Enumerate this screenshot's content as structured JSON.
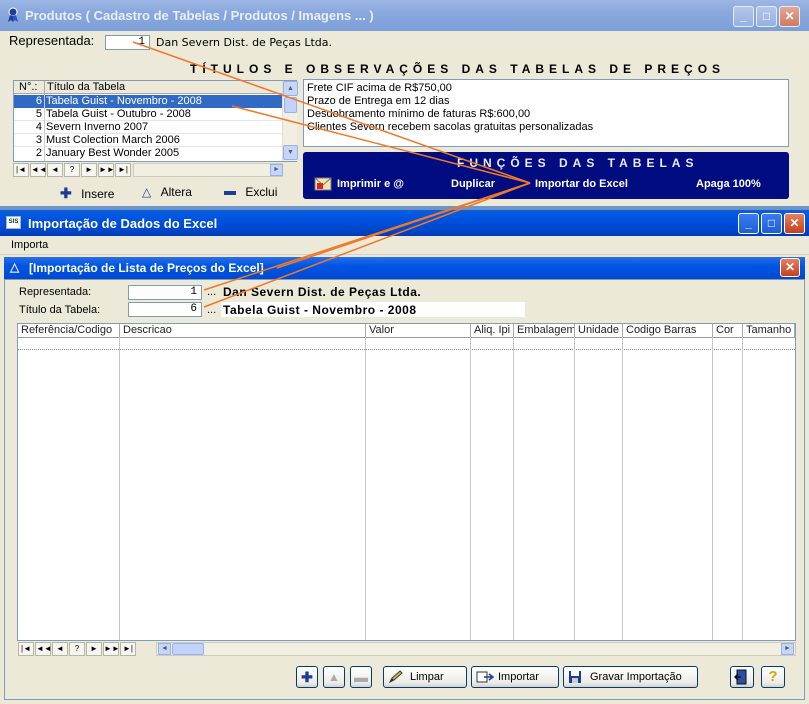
{
  "window1": {
    "title": "Produtos ( Cadastro de Tabelas / Produtos / Imagens ... )",
    "representada_label": "Representada:",
    "representada_value": "1",
    "representada_name": "Dan Severn Dist. de Peças Ltda.",
    "section_title": "TÍTULOS E OBSERVAÇÕES DAS TABELAS DE PREÇOS",
    "list_headers": {
      "num": "N°.:",
      "title": "Título da Tabela"
    },
    "list_items": [
      {
        "num": "6",
        "title": "Tabela Guist - Novembro - 2008",
        "selected": true
      },
      {
        "num": "5",
        "title": "Tabela Guist - Outubro - 2008"
      },
      {
        "num": "4",
        "title": "Severn Inverno 2007"
      },
      {
        "num": "3",
        "title": "Must Colection March 2006"
      },
      {
        "num": "2",
        "title": "January Best Wonder 2005"
      }
    ],
    "nav_buttons": [
      "|◄",
      "◄◄",
      "◄",
      "?",
      "►",
      "►►",
      "►|"
    ],
    "observations": [
      "Frete CIF acima de R$750,00",
      "Prazo de Entrega em 12 dias",
      "Desdobramento mínimo de faturas R$:600,00",
      "Clientes Severn recebem sacolas gratuitas personalizadas"
    ],
    "actions": {
      "insere": "Insere",
      "altera": "Altera",
      "exclui": "Exclui"
    },
    "funcs_title": "FUNÇÕES DAS TABELAS",
    "funcs": {
      "imprimir": "Imprimir e @",
      "duplicar": "Duplicar",
      "importar": "Importar do Excel",
      "apaga": "Apaga 100%"
    }
  },
  "window2": {
    "title": "Importação de Dados do Excel",
    "menu": [
      "Importa"
    ],
    "subtitle": "[Importação de Lista de Preços do Excel]",
    "representada_label": "Representada:",
    "representada_value": "1",
    "representada_name": "Dan Severn Dist. de Peças Ltda.",
    "titulo_label": "Título da Tabela:",
    "titulo_value": "6",
    "titulo_name": "Tabela Guist - Novembro - 2008",
    "ellipsis": "...",
    "columns": [
      "Referência/Codigo",
      "Descricao",
      "Valor",
      "Aliq. Ipi",
      "Embalagem",
      "Unidade",
      "Codigo Barras",
      "Cor",
      "Tamanho"
    ],
    "nav_buttons": [
      "|◄",
      "◄◄",
      "◄",
      "?",
      "►",
      "►►",
      "►|"
    ],
    "buttons": {
      "limpar": "Limpar",
      "importar": "Importar",
      "gravar": "Gravar Importação"
    }
  },
  "colors": {
    "desktop": "#6d93c8",
    "xp_blue": "#0054e3",
    "selection": "#316ac5",
    "funcs_panel": "#000c80",
    "arrows": "#f07828"
  }
}
